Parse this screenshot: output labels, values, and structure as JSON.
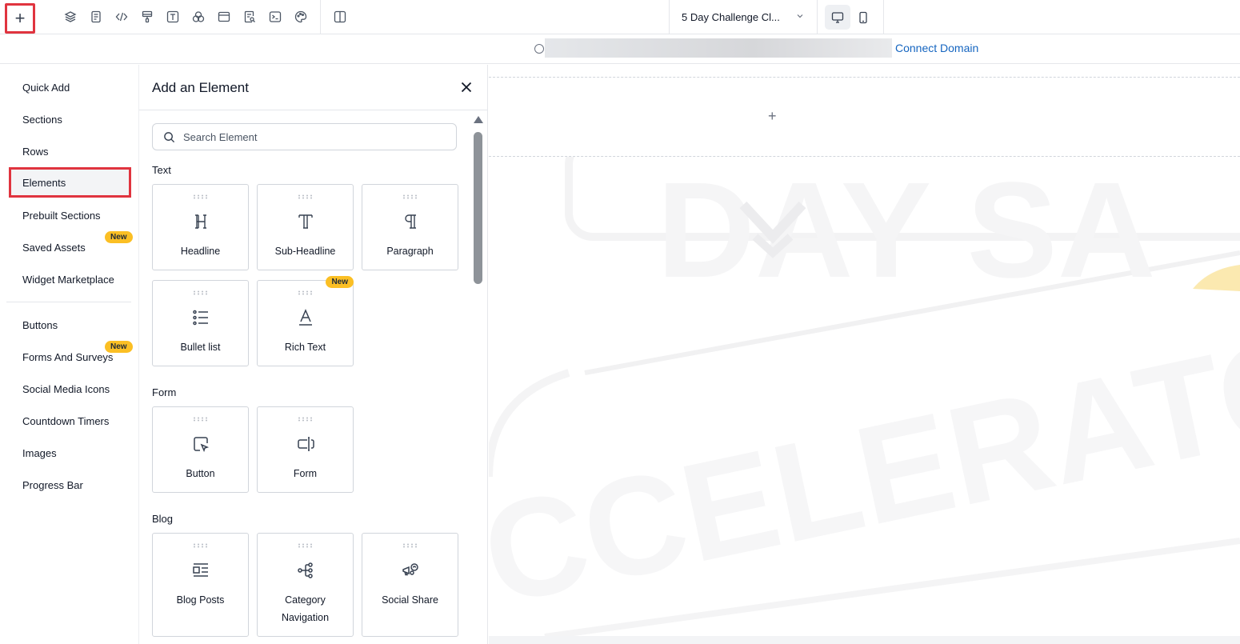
{
  "toolbar": {
    "add_label": "+",
    "page_select": "5 Day Challenge Cl...",
    "icons": [
      "layers-icon",
      "page-icon",
      "code-icon",
      "paint-icon",
      "text-icon",
      "color-icon",
      "layout-icon",
      "search-page-icon",
      "terminal-icon",
      "palette-icon",
      "split-view-icon"
    ],
    "devices": [
      "desktop-icon",
      "mobile-icon"
    ]
  },
  "urlbar": {
    "connect_label": "Connect Domain"
  },
  "nav": {
    "items": [
      {
        "label": "Quick Add"
      },
      {
        "label": "Sections"
      },
      {
        "label": "Rows"
      },
      {
        "label": "Elements"
      },
      {
        "label": "Prebuilt Sections"
      },
      {
        "label": "Saved Assets",
        "badge": "New"
      },
      {
        "label": "Widget Marketplace"
      },
      {
        "label": "Buttons"
      },
      {
        "label": "Forms And Surveys",
        "badge": "New"
      },
      {
        "label": "Social Media Icons"
      },
      {
        "label": "Countdown Timers"
      },
      {
        "label": "Images"
      },
      {
        "label": "Progress Bar"
      }
    ]
  },
  "panel": {
    "title": "Add an Element",
    "search_placeholder": "Search Element",
    "sections": {
      "text": "Text",
      "form": "Form",
      "blog": "Blog"
    },
    "cards": {
      "headline": "Headline",
      "subheadline": "Sub-Headline",
      "paragraph": "Paragraph",
      "bullet": "Bullet list",
      "richtext": "Rich Text",
      "richtext_badge": "New",
      "button": "Button",
      "form": "Form",
      "blogposts": "Blog Posts",
      "catnav_1": "Category",
      "catnav_2": "Navigation",
      "socialshare": "Social Share"
    }
  },
  "canvas": {
    "add_label": "+",
    "watermark_top": "DAY SA",
    "watermark_bottom": "CCELERATOR"
  },
  "colors": {
    "highlight_border": "#e0343f",
    "badge": "#fbbf24",
    "link": "#1565c0"
  }
}
